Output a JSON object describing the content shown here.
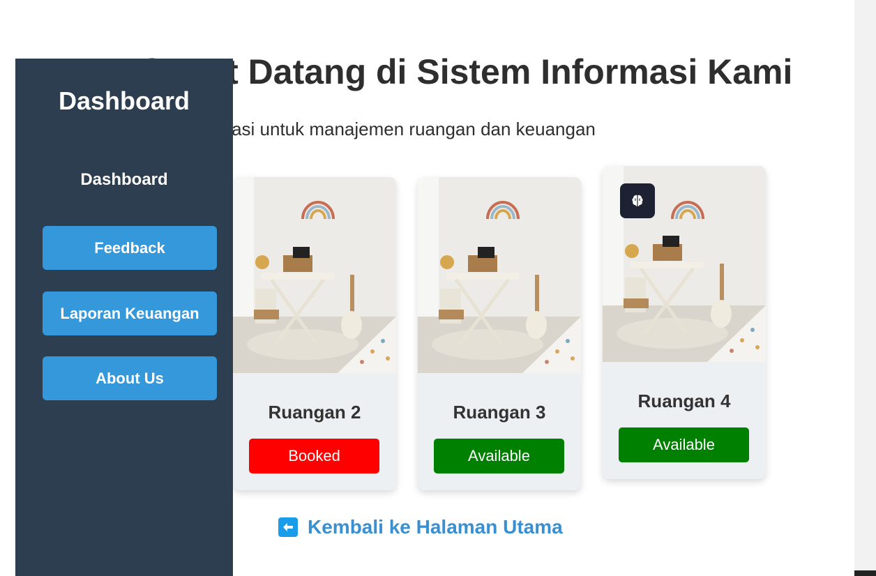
{
  "main": {
    "title": "Selamat Datang di Sistem Informasi Kami",
    "subtitle": "Sistem terintegrasi untuk manajemen ruangan dan keuangan"
  },
  "rooms": [
    {
      "name": "Ruangan 2",
      "status": "Booked",
      "status_color": "#ff0000"
    },
    {
      "name": "Ruangan 3",
      "status": "Available",
      "status_color": "#008000"
    },
    {
      "name": "Ruangan 4",
      "status": "Available",
      "status_color": "#008000",
      "badge_icon": "brain-icon"
    }
  ],
  "back_link": {
    "label": "Kembali ke Halaman Utama",
    "icon": "arrow-left-icon"
  },
  "sidebar": {
    "title": "Dashboard",
    "active_item": "Dashboard",
    "items": [
      {
        "label": "Feedback"
      },
      {
        "label": "Laporan Keuangan"
      },
      {
        "label": "About Us"
      }
    ]
  },
  "colors": {
    "sidebar_bg": "#2c3e50",
    "nav_button": "#3498db",
    "link": "#3a8fd0",
    "booked": "#ff0000",
    "available": "#008000"
  }
}
